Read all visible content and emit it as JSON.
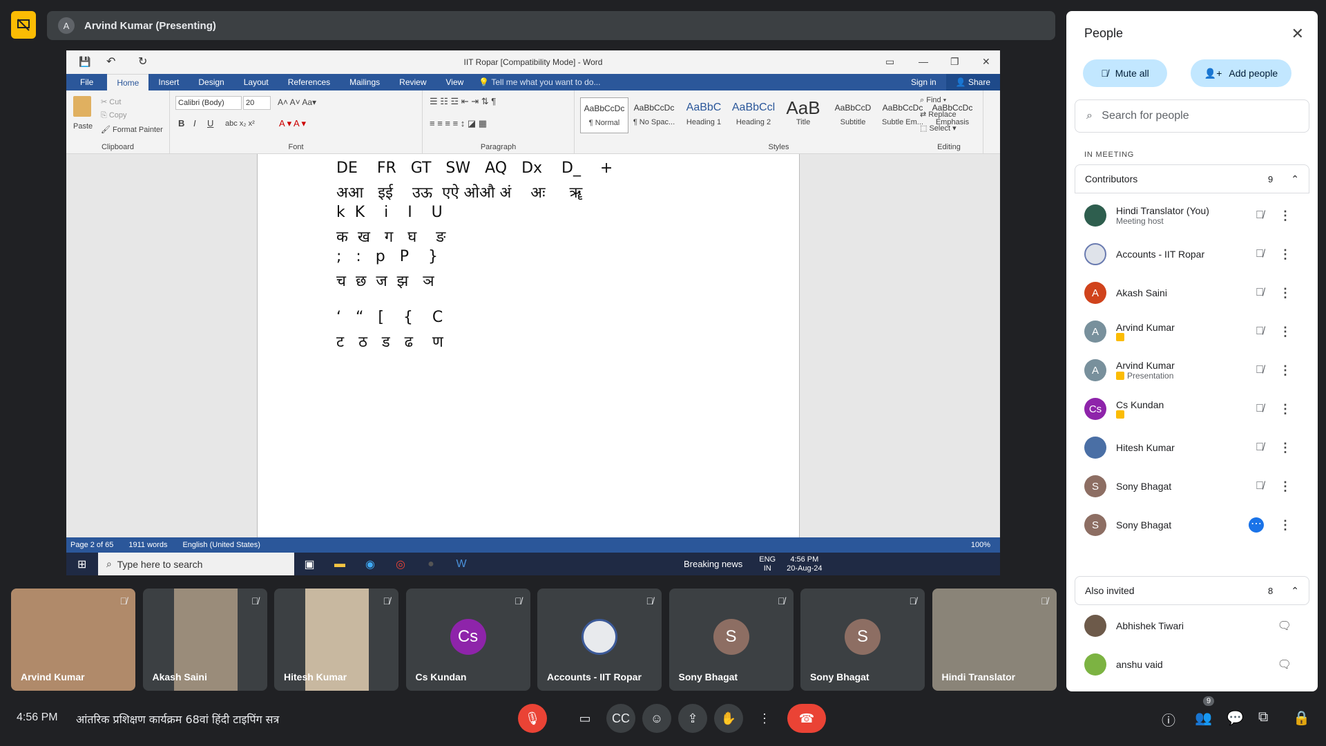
{
  "presenter_bar": {
    "avatar_letter": "A",
    "label": "Arvind Kumar (Presenting)"
  },
  "word": {
    "title": "IIT Ropar [Compatibility Mode] - Word",
    "tabs": [
      "File",
      "Home",
      "Insert",
      "Design",
      "Layout",
      "References",
      "Mailings",
      "Review",
      "View"
    ],
    "tell_me": "Tell me what you want to do...",
    "sign_in": "Sign in",
    "share": "Share",
    "clipboard": {
      "paste": "Paste",
      "cut": "Cut",
      "copy": "Copy",
      "format_painter": "Format Painter",
      "label": "Clipboard"
    },
    "font": {
      "name": "Calibri (Body)",
      "size": "20",
      "label": "Font"
    },
    "paragraph_label": "Paragraph",
    "styles": [
      {
        "preview": "AaBbCcDc",
        "label": "¶ Normal"
      },
      {
        "preview": "AaBbCcDc",
        "label": "¶ No Spac..."
      },
      {
        "preview": "AaBbC",
        "label": "Heading 1"
      },
      {
        "preview": "AaBbCcl",
        "label": "Heading 2"
      },
      {
        "preview": "AaB",
        "label": "Title"
      },
      {
        "preview": "AaBbCcD",
        "label": "Subtitle"
      },
      {
        "preview": "AaBbCcDc",
        "label": "Subtle Em..."
      },
      {
        "preview": "AaBbCcDc",
        "label": "Emphasis"
      }
    ],
    "styles_label": "Styles",
    "editing": {
      "find": "Find",
      "replace": "Replace",
      "select": "Select",
      "label": "Editing"
    },
    "doc_lines": [
      "DE    FR   GT   SW   AQ   Dx    D_    +",
      "अआ   इई    उऊ  एऐ ओऔ अं    अः     ॠ",
      "k  K    i    I    U",
      "क  ख   ग   घ    ङ",
      ";   :   p   P    }",
      "च  छ  ज  झ   ञ",
      "",
      "‘   “   [    {    C",
      "ट   ठ   ड   ढ    ण"
    ],
    "status": {
      "page": "Page 2 of 65",
      "words": "1911 words",
      "lang": "English (United States)",
      "zoom": "100%"
    },
    "taskbar": {
      "search": "Type here to search",
      "news": "Breaking news",
      "lang1": "ENG",
      "lang2": "IN",
      "time": "4:56 PM",
      "date": "20-Aug-24"
    }
  },
  "tiles": [
    {
      "name": "Arvind Kumar",
      "type": "video",
      "color": "#b08a6a"
    },
    {
      "name": "Akash Saini",
      "type": "video",
      "color": "#9a8c7a"
    },
    {
      "name": "Hitesh Kumar",
      "type": "video",
      "color": "#c8b8a0"
    },
    {
      "name": "Cs Kundan",
      "type": "avatar",
      "letter": "Cs",
      "color": "#8e24aa"
    },
    {
      "name": "Accounts - IIT Ropar",
      "type": "logo",
      "letter": "",
      "color": "#e8eaed"
    },
    {
      "name": "Sony Bhagat",
      "type": "avatar",
      "letter": "S",
      "color": "#8d6e63"
    },
    {
      "name": "Sony Bhagat",
      "type": "avatar",
      "letter": "S",
      "color": "#8d6e63"
    },
    {
      "name": "Hindi Translator",
      "type": "video",
      "color": "#8a8478"
    }
  ],
  "bottom": {
    "time": "4:56 PM",
    "meeting_title": "आंतरिक प्रशिक्षण कार्यक्रम 68वां हिंदी टाइपिंग सत्र",
    "people_count": "9"
  },
  "people": {
    "title": "People",
    "mute_all": "Mute all",
    "add_people": "Add people",
    "search_placeholder": "Search for people",
    "in_meeting": "IN MEETING",
    "contributors": {
      "label": "Contributors",
      "count": "9"
    },
    "members": [
      {
        "name": "Hindi Translator (You)",
        "sub": "Meeting host",
        "letter": "",
        "color": "#2e5e4e",
        "badge": false
      },
      {
        "name": "Accounts - IIT Ropar",
        "sub": "",
        "letter": "",
        "color": "#dfe3ea",
        "badge": false
      },
      {
        "name": "Akash Saini",
        "sub": "",
        "letter": "A",
        "color": "#d0431c",
        "badge": false
      },
      {
        "name": "Arvind Kumar",
        "sub": "",
        "letter": "A",
        "color": "#78909c",
        "badge": true
      },
      {
        "name": "Arvind Kumar",
        "sub": "Presentation",
        "letter": "A",
        "color": "#78909c",
        "badge": true
      },
      {
        "name": "Cs Kundan",
        "sub": "",
        "letter": "Cs",
        "color": "#8e24aa",
        "badge": true
      },
      {
        "name": "Hitesh Kumar",
        "sub": "",
        "letter": "",
        "color": "#4a6fa5",
        "badge": false
      },
      {
        "name": "Sony Bhagat",
        "sub": "",
        "letter": "S",
        "color": "#8d6e63",
        "badge": false
      },
      {
        "name": "Sony Bhagat",
        "sub": "",
        "letter": "S",
        "color": "#8d6e63",
        "badge": false
      }
    ],
    "also_invited": {
      "label": "Also invited",
      "count": "8"
    },
    "invited": [
      {
        "name": "Abhishek Tiwari",
        "color": "#6d5a4a"
      },
      {
        "name": "anshu vaid",
        "color": "#7cb342"
      }
    ]
  }
}
